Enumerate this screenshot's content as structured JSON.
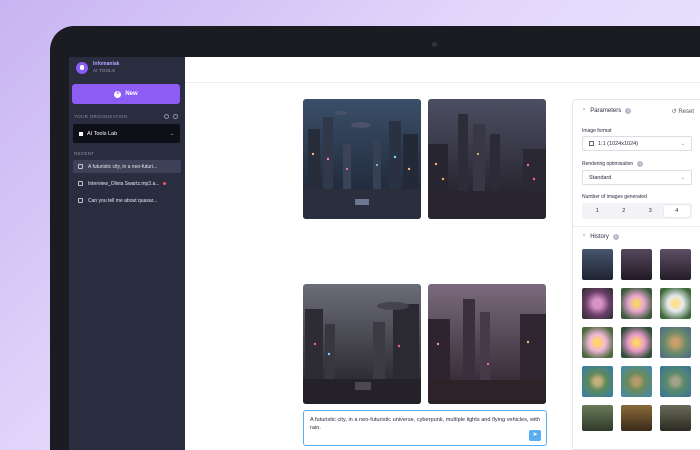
{
  "sidebar": {
    "brand_name": "Infomaniak",
    "brand_sub": "AI TOOLS",
    "new_label": "New",
    "org_label": "YOUR ORGANISATION",
    "org_value": "AI Tools Lab",
    "recent_label": "RECENT",
    "recent_items": [
      {
        "label": "A futuristic city, in a neo-futuri...",
        "icon": "image-icon"
      },
      {
        "label": "Interview_Olivia Swartz.mp3.a...",
        "icon": "transcript-icon"
      },
      {
        "label": "Can you tell me about quasar...",
        "icon": "chat-icon"
      }
    ]
  },
  "prompt": {
    "text": "A futuristic city, in a neo-futuristic universe, cyberpunk, multiple lights and flying vehicles, with rain."
  },
  "parameters": {
    "title": "Parameters",
    "reset_label": "Reset",
    "image_format_label": "Image format",
    "image_format_value": "1:1 (1024x1024)",
    "rendering_label": "Rendering optimisation",
    "rendering_value": "Standard",
    "count_label": "Number of images generated",
    "counts": [
      "1",
      "2",
      "3",
      "4"
    ],
    "selected_count": "4"
  },
  "history": {
    "title": "History"
  },
  "colors": {
    "accent": "#8c5cf5",
    "sidebar_bg": "#2a2d3f",
    "prompt_border": "#5aaef0"
  }
}
